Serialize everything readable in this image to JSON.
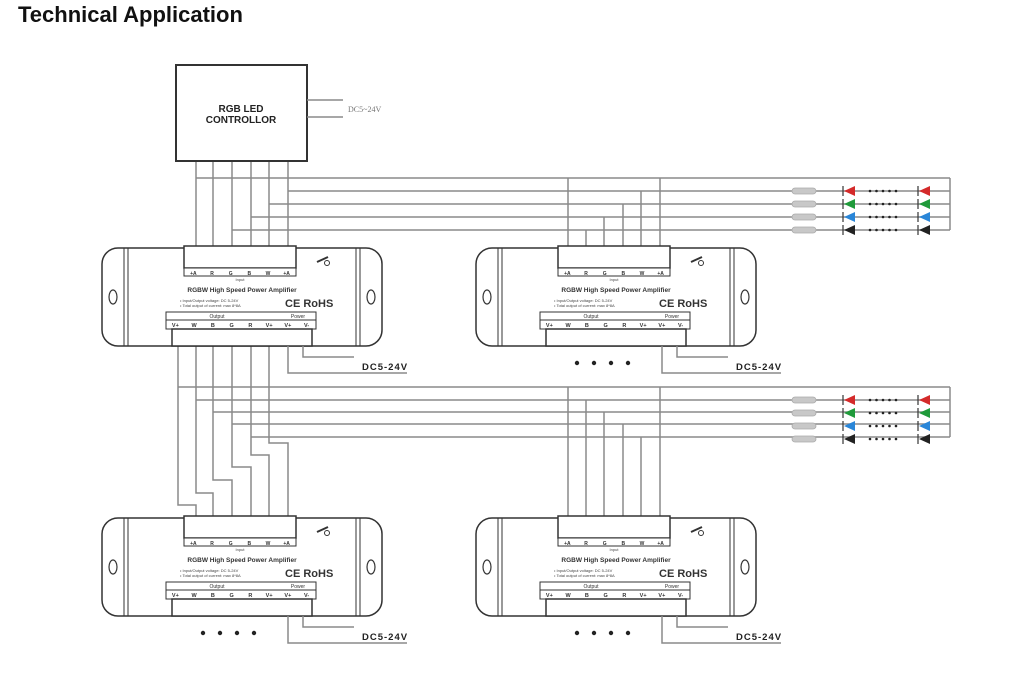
{
  "page": {
    "title": "Technical Application"
  },
  "controller": {
    "label_line1": "RGB LED",
    "label_line2": "CONTROLLOR",
    "power_label": "DC5~24V"
  },
  "amplifiers": [
    {
      "id": "amp-top-left",
      "name": "RGBW High Speed Power Amplifier",
      "spec_line1": "Input/Output voltage: DC 5-24V",
      "spec_line2": "Total output of current: max 8*8A",
      "input_label": "Input",
      "input_terminals": [
        "+A",
        "R",
        "G",
        "B",
        "W",
        "+A"
      ],
      "output_label": "Output",
      "output_terminals": [
        "V+",
        "W",
        "B",
        "G",
        "R",
        "V+"
      ],
      "power_label": "Power",
      "power_terminals": [
        "V+",
        "V-"
      ],
      "marks": "CE RoHS",
      "supply_label": "DC5-24V",
      "show_continuation_dots": false
    },
    {
      "id": "amp-top-right",
      "name": "RGBW High Speed Power Amplifier",
      "spec_line1": "Input/Output voltage: DC 5-24V",
      "spec_line2": "Total output of current: max 8*8A",
      "input_label": "Input",
      "input_terminals": [
        "+A",
        "R",
        "G",
        "B",
        "W",
        "+A"
      ],
      "output_label": "Output",
      "output_terminals": [
        "V+",
        "W",
        "B",
        "G",
        "R",
        "V+"
      ],
      "power_label": "Power",
      "power_terminals": [
        "V+",
        "V-"
      ],
      "marks": "CE RoHS",
      "supply_label": "DC5-24V",
      "show_continuation_dots": true
    },
    {
      "id": "amp-bottom-left",
      "name": "RGBW High Speed Power Amplifier",
      "spec_line1": "Input/Output voltage: DC 5-24V",
      "spec_line2": "Total output of current: max 8*8A",
      "input_label": "Input",
      "input_terminals": [
        "+A",
        "R",
        "G",
        "B",
        "W",
        "+A"
      ],
      "output_label": "Output",
      "output_terminals": [
        "V+",
        "W",
        "B",
        "G",
        "R",
        "V+"
      ],
      "power_label": "Power",
      "power_terminals": [
        "V+",
        "V-"
      ],
      "marks": "CE RoHS",
      "supply_label": "DC5-24V",
      "show_continuation_dots": true
    },
    {
      "id": "amp-bottom-right",
      "name": "RGBW High Speed Power Amplifier",
      "spec_line1": "Input/Output voltage: DC 5-24V",
      "spec_line2": "Total output of current: max 8*8A",
      "input_label": "Input",
      "input_terminals": [
        "+A",
        "R",
        "G",
        "B",
        "W",
        "+A"
      ],
      "output_label": "Output",
      "output_terminals": [
        "V+",
        "W",
        "B",
        "G",
        "R",
        "V+"
      ],
      "power_label": "Power",
      "power_terminals": [
        "V+",
        "V-"
      ],
      "marks": "CE RoHS",
      "supply_label": "DC5-24V",
      "show_continuation_dots": true
    }
  ],
  "led_strips": [
    {
      "id": "strip-group-1",
      "channels": [
        "red",
        "green",
        "blue",
        "black"
      ]
    },
    {
      "id": "strip-group-2",
      "channels": [
        "red",
        "green",
        "blue",
        "black"
      ]
    }
  ],
  "colors": {
    "wire": "#8a8a8a",
    "outline": "#333333",
    "led_red": "#d42a2a",
    "led_green": "#1f9a3a",
    "led_blue": "#2a86d8",
    "led_black": "#222222",
    "resistor": "#c8c8c8"
  }
}
